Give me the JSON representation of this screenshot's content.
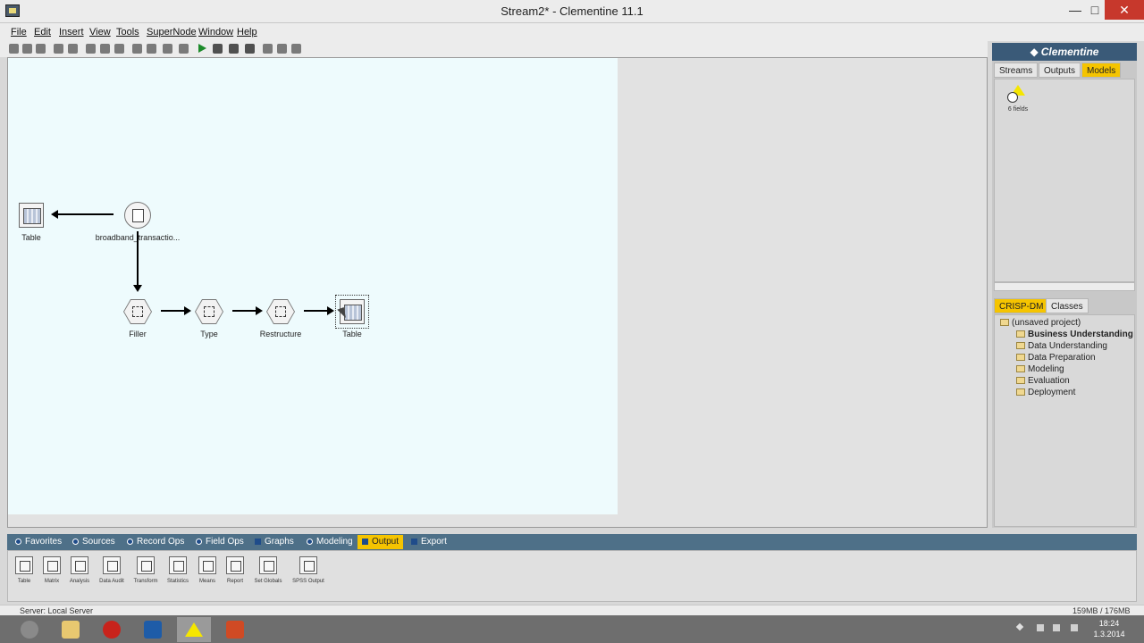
{
  "window": {
    "title": "Stream2* - Clementine 11.1",
    "min_glyph": "—",
    "max_glyph": "□",
    "close_glyph": "✕"
  },
  "menu": [
    "File",
    "Edit",
    "Insert",
    "View",
    "Tools",
    "SuperNode",
    "Window",
    "Help"
  ],
  "stream": {
    "nodes": [
      {
        "id": "table1",
        "label": "Table",
        "kind": "output"
      },
      {
        "id": "source",
        "label": "broadband_transactio...",
        "kind": "source"
      },
      {
        "id": "filler",
        "label": "Filler",
        "kind": "field-op"
      },
      {
        "id": "type",
        "label": "Type",
        "kind": "field-op"
      },
      {
        "id": "restructure",
        "label": "Restructure",
        "kind": "field-op"
      },
      {
        "id": "table2",
        "label": "Table",
        "kind": "output"
      }
    ]
  },
  "right_panel": {
    "brand": "Clementine",
    "manager_tabs": [
      "Streams",
      "Outputs",
      "Models"
    ],
    "active_manager_tab": "Models",
    "model_label": "6 fields",
    "project_tabs": [
      "CRISP-DM",
      "Classes"
    ],
    "active_project_tab": "CRISP-DM",
    "project_root": "(unsaved project)",
    "project_folders": [
      "Business Understanding",
      "Data Understanding",
      "Data Preparation",
      "Modeling",
      "Evaluation",
      "Deployment"
    ],
    "bold_folder": "Business Understanding"
  },
  "palette": {
    "tabs": [
      "Favorites",
      "Sources",
      "Record Ops",
      "Field Ops",
      "Graphs",
      "Modeling",
      "Output",
      "Export"
    ],
    "active_tab": "Output",
    "items": [
      "Table",
      "Matrix",
      "Analysis",
      "Data Audit",
      "Transform",
      "Statistics",
      "Means",
      "Report",
      "Set Globals",
      "SPSS Output"
    ]
  },
  "status": {
    "server": "Server: Local Server",
    "memory": "159MB / 176MB"
  },
  "taskbar": {
    "time": "18:24",
    "date": "1.3.2014"
  },
  "colors": {
    "accent_tab": "#f5c400",
    "palette_bar": "#4e7088",
    "canvas_bg": "#eefbfd",
    "close_button": "#c7382c"
  }
}
